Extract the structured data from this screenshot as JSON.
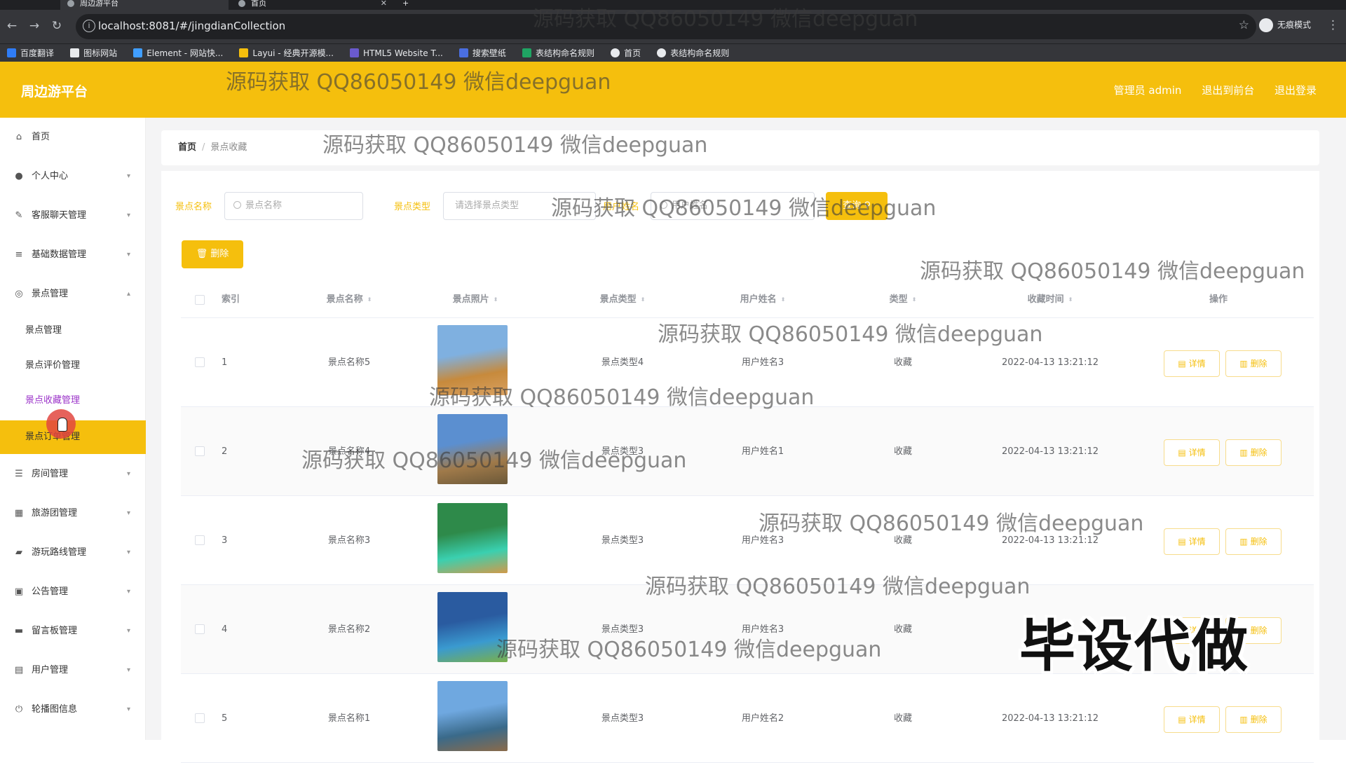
{
  "browser": {
    "tabs": [
      {
        "title": "周边游平台",
        "active": true
      },
      {
        "title": "首页",
        "active": false
      }
    ],
    "url": "localhost:8081/#/jingdianCollection",
    "profile_label": "无痕模式",
    "bookmarks": [
      {
        "label": "百度翻译",
        "color": "#2f7cf6"
      },
      {
        "label": "图标网站",
        "color": "#e8eaed"
      },
      {
        "label": "Element - 网站快...",
        "color": "#409eff"
      },
      {
        "label": "Layui - 经典开源模...",
        "color": "#f5bf0d"
      },
      {
        "label": "HTML5 Website T...",
        "color": "#6a5acd"
      },
      {
        "label": "搜索壁纸",
        "color": "#4a6ee0"
      },
      {
        "label": "表结构命名规则",
        "color": "#1fa463"
      },
      {
        "label": "首页",
        "color": "#e8eaed"
      },
      {
        "label": "表结构命名规则",
        "color": "#e8eaed"
      }
    ]
  },
  "header": {
    "brand": "周边游平台",
    "admin_label": "管理员 admin",
    "front_link": "退出到前台",
    "logout_link": "退出登录"
  },
  "sidebar": {
    "items": [
      {
        "label": "首页",
        "icon": "home-icon",
        "arrow": ""
      },
      {
        "label": "个人中心",
        "icon": "user-icon",
        "arrow": "▾"
      },
      {
        "label": "客服聊天管理",
        "icon": "chat-icon",
        "arrow": "▾"
      },
      {
        "label": "基础数据管理",
        "icon": "list-icon",
        "arrow": "▾"
      },
      {
        "label": "景点管理",
        "icon": "compass-icon",
        "arrow": "▴"
      },
      {
        "label": "房间管理",
        "icon": "sliders-icon",
        "arrow": "▾"
      },
      {
        "label": "旅游团管理",
        "icon": "grid-icon",
        "arrow": "▾"
      },
      {
        "label": "游玩路线管理",
        "icon": "chat-bubble-icon",
        "arrow": "▾"
      },
      {
        "label": "公告管理",
        "icon": "notice-icon",
        "arrow": "▾"
      },
      {
        "label": "留言板管理",
        "icon": "monitor-icon",
        "arrow": "▾"
      },
      {
        "label": "用户管理",
        "icon": "chart-icon",
        "arrow": "▾"
      },
      {
        "label": "轮播图信息",
        "icon": "power-icon",
        "arrow": "▾"
      }
    ],
    "subitems": [
      {
        "label": "景点管理"
      },
      {
        "label": "景点评价管理"
      },
      {
        "label": "景点收藏管理"
      },
      {
        "label": "景点订单管理"
      }
    ]
  },
  "breadcrumb": {
    "home": "首页",
    "separator": "/",
    "current": "景点收藏"
  },
  "filters": {
    "name_label": "景点名称",
    "name_placeholder": "景点名称",
    "type_label": "景点类型",
    "type_placeholder": "请选择景点类型",
    "user_label": "用户姓名",
    "user_placeholder": "用户姓名",
    "search_button": "查询",
    "delete_button": "删除"
  },
  "table": {
    "columns": [
      "索引",
      "景点名称",
      "景点照片",
      "景点类型",
      "用户姓名",
      "类型",
      "收藏时间",
      "操作"
    ],
    "rows": [
      {
        "index": "1",
        "name": "景点名称5",
        "type": "景点类型4",
        "user": "用户姓名3",
        "kind": "收藏",
        "time": "2022-04-13 13:21:12",
        "photo_colors": [
          "#7fb0e0",
          "#c78a3c",
          "#d8a060"
        ]
      },
      {
        "index": "2",
        "name": "景点名称4",
        "type": "景点类型3",
        "user": "用户姓名1",
        "kind": "收藏",
        "time": "2022-04-13 13:21:12",
        "photo_colors": [
          "#5b8fd0",
          "#a07a4a",
          "#6b5838"
        ]
      },
      {
        "index": "3",
        "name": "景点名称3",
        "type": "景点类型3",
        "user": "用户姓名3",
        "kind": "收藏",
        "time": "2022-04-13 13:21:12",
        "photo_colors": [
          "#2e8a4a",
          "#3ad0b0",
          "#d09a4a"
        ]
      },
      {
        "index": "4",
        "name": "景点名称2",
        "type": "景点类型3",
        "user": "用户姓名3",
        "kind": "收藏",
        "time": "2022-04-1",
        "photo_colors": [
          "#2a5ba0",
          "#3a9ad0",
          "#7ab04a"
        ]
      },
      {
        "index": "5",
        "name": "景点名称1",
        "type": "景点类型3",
        "user": "用户姓名2",
        "kind": "收藏",
        "time": "2022-04-13 13:21:12",
        "photo_colors": [
          "#6fa8e0",
          "#3a6a8a",
          "#8a6a4a"
        ]
      }
    ],
    "detail_button": "详情",
    "delete_button": "删除"
  },
  "overlays": {
    "watermark": "源码获取 QQ86050149 微信deepguan",
    "big_text": "毕设代做"
  },
  "colors": {
    "accent": "#f5bf0d",
    "active_submenu": "#9b33c9"
  }
}
